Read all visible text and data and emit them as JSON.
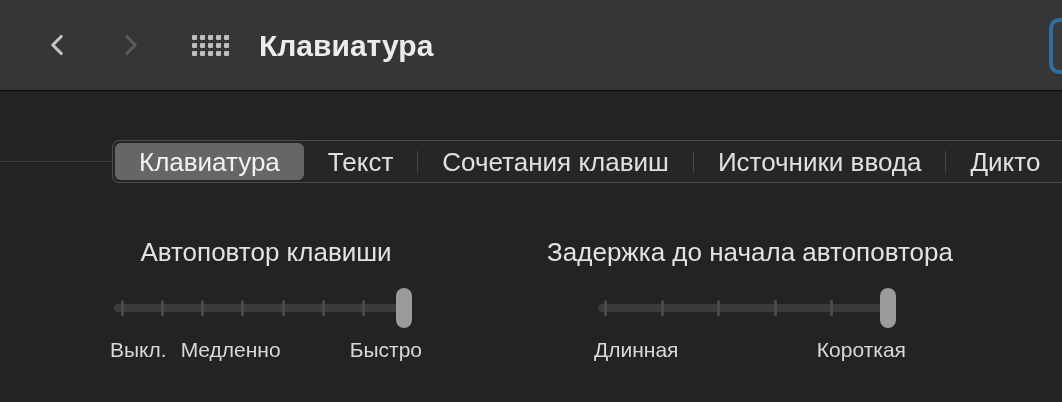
{
  "toolbar": {
    "title": "Клавиатура",
    "back_disabled": false,
    "forward_disabled": true
  },
  "tabs": [
    {
      "label": "Клавиатура",
      "selected": true
    },
    {
      "label": "Текст",
      "selected": false
    },
    {
      "label": "Сочетания клавиш",
      "selected": false
    },
    {
      "label": "Источники ввода",
      "selected": false
    },
    {
      "label": "Дикто",
      "selected": false
    }
  ],
  "sliders": [
    {
      "title": "Автоповтор клавиши",
      "level": 1,
      "labels": [
        "Выкл.",
        "Медленно",
        "Быстро"
      ]
    },
    {
      "title": "Задержка до начала автоповтора",
      "level": 1,
      "labels": [
        "Длинная",
        "Короткая"
      ]
    }
  ]
}
